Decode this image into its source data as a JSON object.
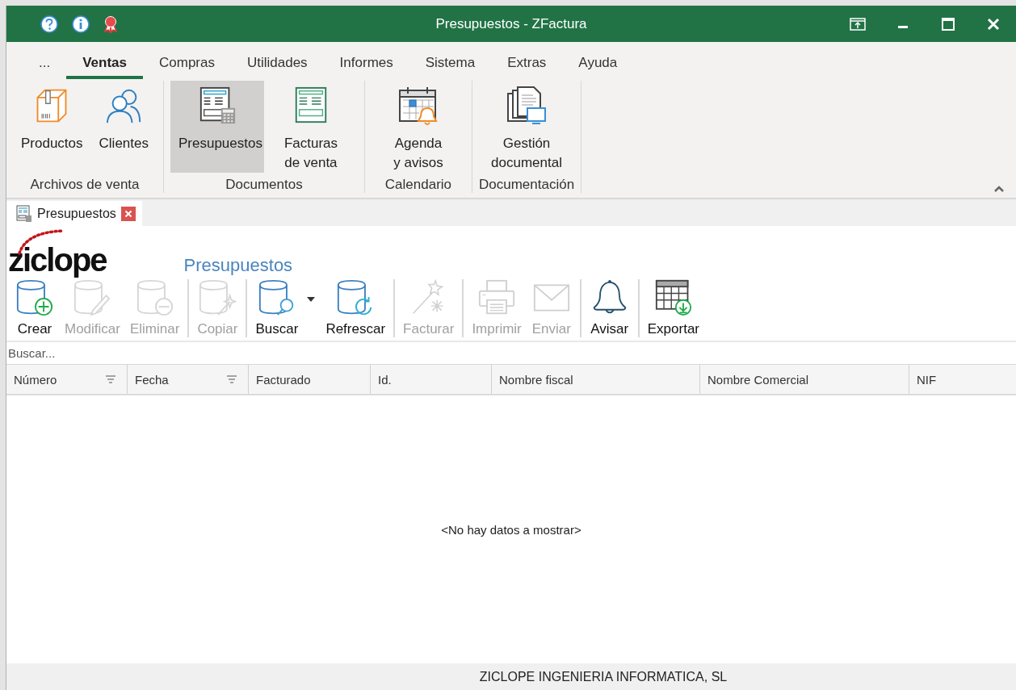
{
  "window": {
    "title": "Presupuestos - ZFactura"
  },
  "ribbon": {
    "tabs": [
      {
        "label": "...",
        "selected": false
      },
      {
        "label": "Ventas",
        "selected": true
      },
      {
        "label": "Compras",
        "selected": false
      },
      {
        "label": "Utilidades",
        "selected": false
      },
      {
        "label": "Informes",
        "selected": false
      },
      {
        "label": "Sistema",
        "selected": false
      },
      {
        "label": "Extras",
        "selected": false
      },
      {
        "label": "Ayuda",
        "selected": false
      }
    ],
    "groups": [
      {
        "label": "Archivos de venta",
        "items": [
          {
            "label": "Productos",
            "kind": "box",
            "selected": false
          },
          {
            "label": "Clientes",
            "kind": "people",
            "selected": false
          }
        ]
      },
      {
        "label": "Documentos",
        "items": [
          {
            "label": "Presupuestos",
            "kind": "quote",
            "selected": true
          },
          {
            "label": "Facturas de venta",
            "kind": "invoice",
            "selected": false
          }
        ]
      },
      {
        "label": "Calendario",
        "items": [
          {
            "label": "Agenda y avisos",
            "kind": "calendar",
            "selected": false
          }
        ]
      },
      {
        "label": "Documentación",
        "items": [
          {
            "label": "Gestión documental",
            "kind": "documents",
            "selected": false
          }
        ]
      }
    ]
  },
  "doc_tabs": [
    {
      "label": "Presupuestos",
      "selected": true
    }
  ],
  "logo": "ziclope",
  "page_title": "Presupuestos",
  "toolbar": [
    [
      {
        "label": "Crear",
        "kind": "create",
        "disabled": false
      },
      {
        "label": "Modificar",
        "kind": "edit",
        "disabled": true
      },
      {
        "label": "Eliminar",
        "kind": "delete",
        "disabled": true
      }
    ],
    [
      {
        "label": "Copiar",
        "kind": "copy",
        "disabled": true
      }
    ],
    [
      {
        "label": "Buscar",
        "kind": "search",
        "disabled": false,
        "dropdown": true
      },
      {
        "label": "Refrescar",
        "kind": "refresh",
        "disabled": false
      }
    ],
    [
      {
        "label": "Facturar",
        "kind": "wand",
        "disabled": true
      }
    ],
    [
      {
        "label": "Imprimir",
        "kind": "print",
        "disabled": true
      },
      {
        "label": "Enviar",
        "kind": "mail",
        "disabled": true
      }
    ],
    [
      {
        "label": "Avisar",
        "kind": "bell",
        "disabled": false
      }
    ],
    [
      {
        "label": "Exportar",
        "kind": "export",
        "disabled": false
      }
    ]
  ],
  "search": {
    "placeholder": "Buscar..."
  },
  "table": {
    "columns": [
      {
        "label": "Número",
        "sortable": true
      },
      {
        "label": "Fecha",
        "sortable": true
      },
      {
        "label": "Facturado",
        "sortable": false
      },
      {
        "label": "Id.",
        "sortable": false
      },
      {
        "label": "Nombre fiscal",
        "sortable": false
      },
      {
        "label": "Nombre Comercial",
        "sortable": false
      },
      {
        "label": "NIF",
        "sortable": false
      }
    ],
    "empty_text": "<No hay datos a mostrar>"
  },
  "status_bar": "ZICLOPE INGENIERIA INFORMATICA, SL"
}
